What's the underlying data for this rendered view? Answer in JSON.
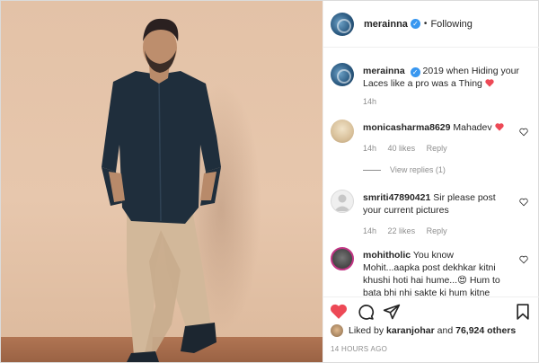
{
  "post": {
    "author": "merainna",
    "follow_status": "Following",
    "dot": "•",
    "caption": "2019 when Hiding your Laces like a pro was a Thing",
    "caption_time": "14h",
    "likes_prefix": "Liked by",
    "liked_by": "karanjohar",
    "likes_and": "and",
    "likes_count": "76,924 others",
    "timestamp": "14 HOURS AGO"
  },
  "comments": [
    {
      "user": "monicasharma8629",
      "text": "Mahadev",
      "time": "14h",
      "likes": "40 likes",
      "reply": "Reply",
      "view_replies": "View replies (1)"
    },
    {
      "user": "smriti47890421",
      "text": "Sir please post your current pictures",
      "time": "14h",
      "likes": "22 likes",
      "reply": "Reply"
    },
    {
      "user": "mohitholic",
      "text": "You know Mohit...aapka post dekhkar kitni khushi hoti hai hume...😍 Hum to bata bhi nhi sakte ki hum kitne"
    }
  ],
  "icons": {
    "verified": "verified-badge-icon",
    "like": "heart-icon",
    "comment": "comment-icon",
    "share": "paper-plane-icon",
    "save": "bookmark-icon"
  },
  "colors": {
    "like_red": "#ed4956",
    "verified_blue": "#3897f0",
    "muted": "#8e8e8e"
  }
}
